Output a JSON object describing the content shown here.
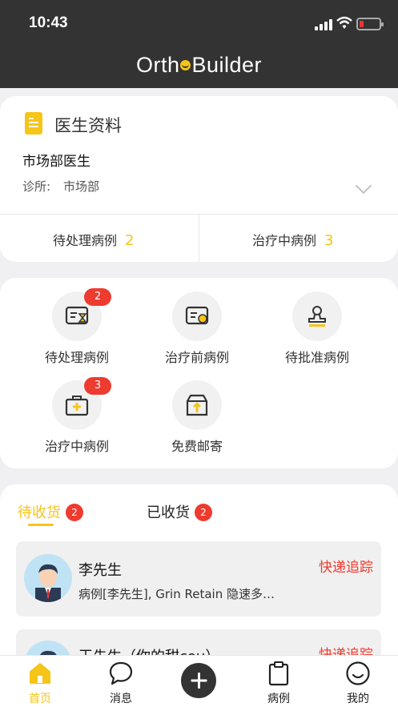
{
  "status": {
    "time": "10:43"
  },
  "app": {
    "logo_left": "Orth",
    "logo_right": "Builder"
  },
  "profile": {
    "title": "医生资料",
    "doctor_name": "市场部医生",
    "clinic_label": "诊所:",
    "clinic_value": "市场部",
    "pending_label": "待处理病例",
    "pending_count": "2",
    "treating_label": "治疗中病例",
    "treating_count": "3"
  },
  "menu": {
    "items": [
      {
        "label": "待处理病例",
        "icon": "pending-case-icon",
        "badge": "2"
      },
      {
        "label": "治疗前病例",
        "icon": "pretreatment-case-icon",
        "badge": ""
      },
      {
        "label": "待批准病例",
        "icon": "approval-stamp-icon",
        "badge": ""
      },
      {
        "label": "治疗中病例",
        "icon": "medical-kit-icon",
        "badge": "3"
      },
      {
        "label": "免费邮寄",
        "icon": "shipping-box-icon",
        "badge": ""
      }
    ]
  },
  "delivery": {
    "tab_pending": "待收货",
    "tab_pending_count": "2",
    "tab_received": "已收货",
    "tab_received_count": "2",
    "orders": [
      {
        "name": "李先生",
        "desc": "病例[李先生], Grin Retain 隐速多…",
        "link": "快递追踪"
      },
      {
        "name": "王先生（你的甜cou）",
        "desc": "",
        "link": "快递追踪"
      }
    ]
  },
  "tabbar": {
    "home": "首页",
    "messages": "消息",
    "cases": "病例",
    "mine": "我的"
  },
  "colors": {
    "accent": "#f5c518",
    "badge": "#ee3b2f",
    "header": "#333333"
  }
}
